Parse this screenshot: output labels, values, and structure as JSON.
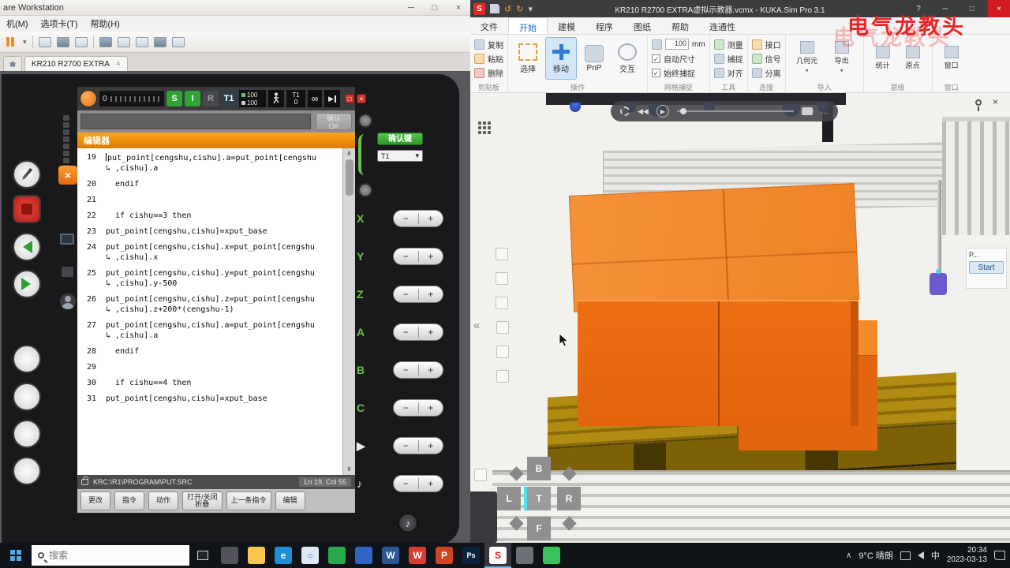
{
  "vmware": {
    "title": "are Workstation",
    "controls": {
      "min": "─",
      "max": "□",
      "close": "×"
    },
    "menu": [
      "机(M)",
      "选项卡(T)",
      "帮助(H)"
    ],
    "tab_label": "KR210 R2700 EXTRA",
    "tab_close": "×",
    "toolbar_caret": "▾"
  },
  "pendant": {
    "statusbar": {
      "counter": "0",
      "indicators": [
        {
          "t": "S",
          "cls": "on"
        },
        {
          "t": "I",
          "cls": "on"
        },
        {
          "t": "R",
          "cls": "off"
        },
        {
          "t": "T1",
          "cls": "mode"
        }
      ],
      "speed_program": "100",
      "speed_jog": "100",
      "mode_box": "T1",
      "mode_sub": "0",
      "infinity": "∞",
      "red_icon_1": "□",
      "red_icon_2": "×"
    },
    "message_bar": {
      "text": "",
      "ok_line1": "确认",
      "ok_line2": "OK"
    },
    "editor": {
      "title": "编辑器",
      "close": "×",
      "scroll_up": "∧",
      "scroll_down": "∨",
      "lines": [
        {
          "n": "19",
          "t": "put_point[cengshu,cishu].a=put_point[cengshu",
          "c": "↳ ,cishu].a",
          "cls": "cur"
        },
        {
          "n": "20",
          "t": "  endif"
        },
        {
          "n": "21",
          "t": ""
        },
        {
          "n": "22",
          "t": "  if cishu==3 then"
        },
        {
          "n": "23",
          "t": "put_point[cengshu,cishu]=xput_base"
        },
        {
          "n": "24",
          "t": "put_point[cengshu,cishu].x=put_point[cengshu",
          "c": "↳ ,cishu].x"
        },
        {
          "n": "25",
          "t": "put_point[cengshu,cishu].y=put_point[cengshu",
          "c": "↳ ,cishu].y-500"
        },
        {
          "n": "26",
          "t": "put_point[cengshu,cishu].z=put_point[cengshu",
          "c": "↳ ,cishu].z+200*(cengshu-1)"
        },
        {
          "n": "27",
          "t": "put_point[cengshu,cishu].a=put_point[cengshu",
          "c": "↳ ,cishu].a"
        },
        {
          "n": "28",
          "t": "  endif"
        },
        {
          "n": "29",
          "t": ""
        },
        {
          "n": "30",
          "t": "  if cishu==4 then"
        },
        {
          "n": "31",
          "t": "put_point[cengshu,cishu]=xput_base"
        }
      ],
      "status_path": "KRC:\\R1\\PROGRAM\\PUT.SRC",
      "status_pos": "Ln 19, Col 55"
    },
    "softkeys": [
      {
        "l1": "更改"
      },
      {
        "l1": "指令"
      },
      {
        "l1": "动作"
      },
      {
        "l1": "打开/关闭",
        "l2": "折叠"
      },
      {
        "l1": "上一条指令"
      },
      {
        "l1": "编辑"
      }
    ],
    "right_panel": {
      "confirm_key": "确认键",
      "mode_select": "T1",
      "mode_caret": "▾",
      "jog_minus": "−",
      "jog_plus": "+",
      "jog_rows": [
        {
          "t": "X",
          "cls": "ax-green"
        },
        {
          "t": "Y",
          "cls": "ax-green"
        },
        {
          "t": "Z",
          "cls": "ax-green"
        },
        {
          "t": "A",
          "cls": "ax-green"
        },
        {
          "t": "B",
          "cls": "ax-green"
        },
        {
          "t": "C",
          "cls": "ax-green"
        },
        {
          "t": "▶",
          "cls": "ax-white"
        },
        {
          "t": "♪",
          "cls": "ax-white"
        }
      ],
      "note_key": "♪"
    }
  },
  "sim": {
    "titlebar": {
      "logo": "S",
      "undo": "↺",
      "redo": "↻",
      "title": "KR210 R2700 EXTRA虚拟示教器.vcmx - KUKA.Sim Pro 3.1",
      "help": "?",
      "min": "─",
      "max": "□",
      "close": "×"
    },
    "tabs": [
      {
        "label": "文件"
      },
      {
        "label": "开始",
        "cls": "active"
      },
      {
        "label": "建模"
      },
      {
        "label": "程序"
      },
      {
        "label": "图纸"
      },
      {
        "label": "帮助"
      },
      {
        "label": "连通性"
      }
    ],
    "ribbon": {
      "clipboard": {
        "label": "剪贴板",
        "items": [
          {
            "t": "复制",
            "ic": ""
          },
          {
            "t": "粘贴",
            "ic": "org"
          },
          {
            "t": "删除",
            "ic": "del"
          }
        ]
      },
      "operation": {
        "label": "操作",
        "items": [
          {
            "t": "选择",
            "ic": "ric-sel"
          },
          {
            "t": "移动",
            "ic": "ric-move",
            "cls": "active"
          },
          {
            "t": "PnP",
            "ic": "ric-pnp"
          },
          {
            "t": "交互",
            "ic": "ric-int"
          }
        ]
      },
      "grid_snap": {
        "label": "网格捕捉",
        "size": "100",
        "unit": "mm",
        "check": "✓",
        "checks": [
          {
            "t": "自动尺寸"
          },
          {
            "t": "始终捕捉"
          }
        ]
      },
      "tools": {
        "label": "工具",
        "items": [
          {
            "t": "测量",
            "ic": "grn"
          },
          {
            "t": "捕捉",
            "ic": ""
          },
          {
            "t": "对齐",
            "ic": ""
          }
        ]
      },
      "connect": {
        "label": "连接",
        "items": [
          {
            "t": "接口",
            "ic": "org"
          },
          {
            "t": "信号",
            "ic": "grn"
          },
          {
            "t": "分离",
            "ic": ""
          }
        ]
      },
      "import_group": {
        "label": "导入",
        "caret": "▾",
        "items": [
          {
            "t": "几何元"
          },
          {
            "t": "导出"
          }
        ]
      },
      "hierarchy": {
        "label": "层级",
        "items": [
          {
            "t": "统计"
          },
          {
            "t": "原点"
          }
        ]
      },
      "window_group": {
        "label": "窗口",
        "items": [
          {
            "t": "窗口"
          }
        ]
      }
    },
    "watermark": "电气龙教头",
    "viewport": {
      "collapse": "«",
      "viewcube": {
        "top": "B",
        "left": "L",
        "center": "T",
        "right": "R",
        "bottom": "F"
      },
      "panel": {
        "label": "P...",
        "button": "Start",
        "close": "×"
      }
    }
  },
  "taskbar": {
    "search_placeholder": "搜索",
    "apps": [
      {
        "bg": "background:#52525a",
        "g": ""
      },
      {
        "bg": "background:#f7c64a",
        "g": ""
      },
      {
        "bg": "background:#1e8fd5",
        "g": "e"
      },
      {
        "bg": "background:#dfe8f2;color:#2b6fc4",
        "g": "○"
      },
      {
        "bg": "background:#27a84a",
        "g": ""
      },
      {
        "bg": "background:#2f66c4",
        "g": ""
      },
      {
        "bg": "background:#2b5797",
        "g": "W"
      },
      {
        "bg": "background:#d83b2f",
        "g": "W"
      },
      {
        "bg": "background:#d04423",
        "g": "P"
      },
      {
        "bg": "background:#0d2440;font-size:9px",
        "g": "Ps"
      },
      {
        "bg": "background:#ffffff;color:#e11a1a",
        "g": "S",
        "slot": "active"
      },
      {
        "bg": "background:#6b7076",
        "g": ""
      },
      {
        "bg": "background:#3ac25a",
        "g": ""
      }
    ],
    "tray": {
      "chevron": "∧",
      "weather": "9°C 晴朗",
      "input_indicator": "中",
      "time": "20:34",
      "date": "2023-03-13"
    }
  }
}
